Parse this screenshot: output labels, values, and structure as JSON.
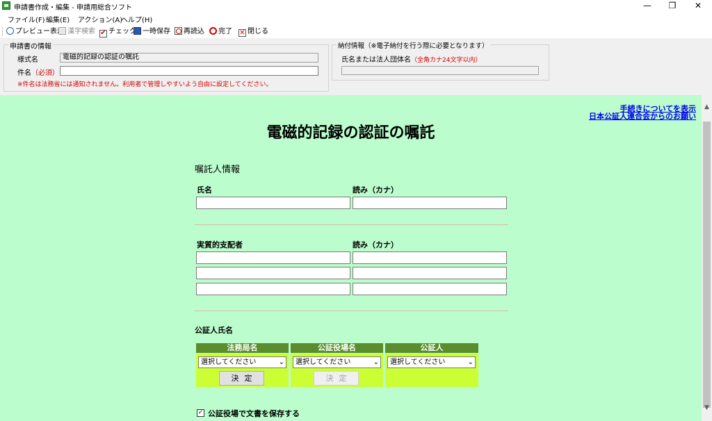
{
  "window": {
    "title": "申請書作成・編集 - 申請用総合ソフト",
    "minimize": "—",
    "restore": "❐",
    "close": "✕"
  },
  "menu": [
    "ファイル(F)",
    "編集(E)",
    "アクション(A)",
    "ヘルプ(H)"
  ],
  "toolbar": {
    "preview": "プレビュー表示",
    "kanji_search": "漢字検索",
    "check": "チェック",
    "temp_save": "一時保存",
    "reload": "再読込",
    "complete": "完了",
    "close": "閉じる"
  },
  "application_info": {
    "group_title": "申請書の情報",
    "form_name_label": "様式名",
    "form_name_value": "電磁的記録の認証の嘱託",
    "subject_label": "件名",
    "required_mark": "（必須）",
    "subject_value": "",
    "note": "※件名は法務省には通知されません。利用者で管理しやすいよう自由に設定してください。"
  },
  "payment_info": {
    "group_title": "納付情報（※電子納付を行う際に必要となります）",
    "name_label": "氏名または法人団体名",
    "name_hint": "（全角カナ24文字以内）",
    "name_value": ""
  },
  "links": {
    "show_procedure": "手続きについてを表示",
    "association_notice": "日本公証人連合会からのお願い"
  },
  "form": {
    "title": "電磁的記録の認証の嘱託",
    "requester_section": "嘱託人情報",
    "name_label": "氏名",
    "kana_label": "読み（カナ）",
    "beneficial_owner_label": "実質的支配者",
    "beneficial_owner_kana_label": "読み（カナ）",
    "notary_section": "公証人氏名",
    "notary_table": {
      "headers": [
        "法務局名",
        "公証役場名",
        "公証人"
      ],
      "placeholder": "選択してください",
      "decide_label": "決定"
    },
    "save_at_office_label": "公証役場で文書を保存する",
    "save_at_office_checked": true
  },
  "colors": {
    "content_bg": "#bbfdcc",
    "table_header": "#5a8e2c",
    "table_cell": "#ccff33",
    "required": "#d40000",
    "link": "#0000ee"
  }
}
